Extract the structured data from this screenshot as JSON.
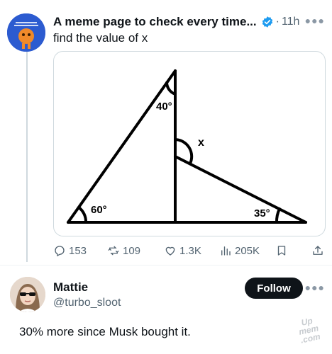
{
  "post": {
    "author": "A meme page to check every time...",
    "separator": "·",
    "time": "11h",
    "text": "find the value of x",
    "figure": {
      "angle_top": "40°",
      "angle_x": "x",
      "angle_left": "60°",
      "angle_right": "35°"
    },
    "stats": {
      "replies": "153",
      "reposts": "109",
      "likes": "1.3K",
      "views": "205K"
    }
  },
  "reply": {
    "name": "Mattie",
    "handle": "@turbo_sloot",
    "follow_label": "Follow",
    "text": "30% more since Musk bought it."
  },
  "watermark": {
    "line1": "Up",
    "line2": "mem",
    "line3": ".com"
  },
  "colors": {
    "verified": "#1d9bf0",
    "muted": "#536471",
    "follow_bg": "#0f1419"
  },
  "icons": [
    "reply-icon",
    "repost-icon",
    "like-icon",
    "views-icon",
    "bookmark-icon",
    "share-icon",
    "verified-badge-icon",
    "more-icon"
  ]
}
